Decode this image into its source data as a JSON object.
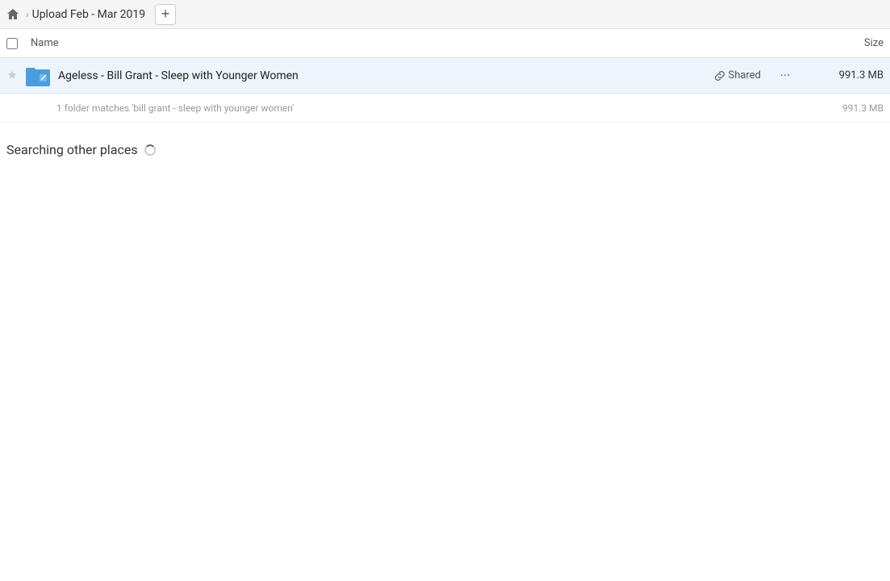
{
  "breadcrumb": {
    "home_icon": "home",
    "separator": "›",
    "title": "Upload Feb - Mar 2019",
    "add_button_label": "+"
  },
  "columns": {
    "name_label": "Name",
    "size_label": "Size"
  },
  "file_row": {
    "name": "Ageless - Bill Grant - Sleep with Younger Women",
    "shared_label": "Shared",
    "size": "991.3 MB",
    "more_icon": "···"
  },
  "match_info": {
    "text": "1 folder matches 'bill grant - sleep with younger women'",
    "size": "991.3 MB"
  },
  "searching": {
    "title": "Searching other places"
  }
}
